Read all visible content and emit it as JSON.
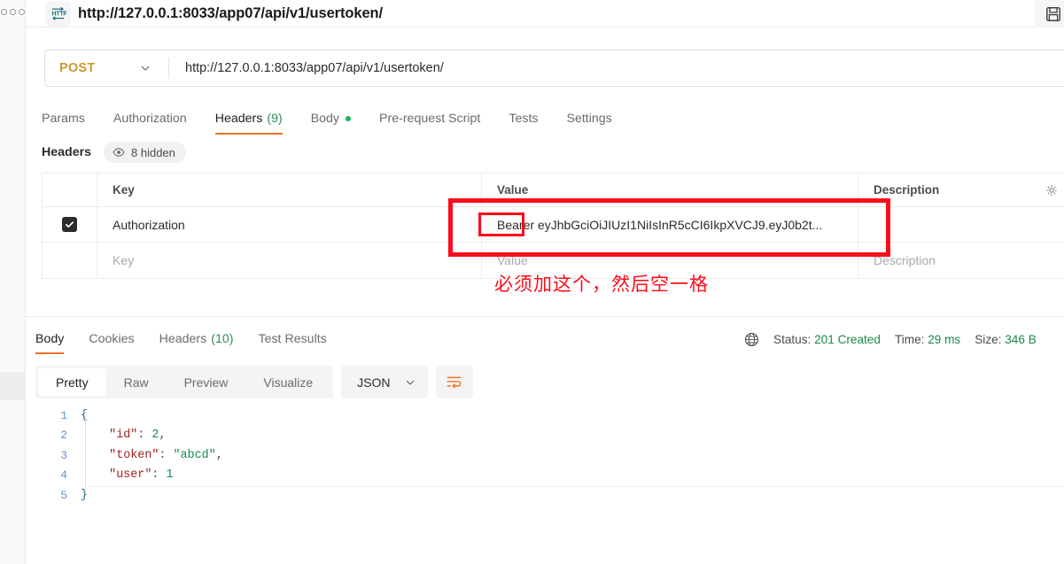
{
  "titlebar": {
    "protocol_icon": "http-icon",
    "tab_title": "http://127.0.0.1:8033/app07/api/v1/usertoken/",
    "save_icon": "save-disk-icon"
  },
  "request": {
    "method": "POST",
    "method_caret_icon": "chevron-down-icon",
    "url": "http://127.0.0.1:8033/app07/api/v1/usertoken/",
    "tabs": [
      {
        "label": "Params",
        "count": "",
        "active": false,
        "dot": false
      },
      {
        "label": "Authorization",
        "count": "",
        "active": false,
        "dot": false
      },
      {
        "label": "Headers",
        "count": "(9)",
        "active": true,
        "dot": false
      },
      {
        "label": "Body",
        "count": "",
        "active": false,
        "dot": true
      },
      {
        "label": "Pre-request Script",
        "count": "",
        "active": false,
        "dot": false
      },
      {
        "label": "Tests",
        "count": "",
        "active": false,
        "dot": false
      },
      {
        "label": "Settings",
        "count": "",
        "active": false,
        "dot": false
      }
    ]
  },
  "headers_panel": {
    "title": "Headers",
    "hidden_chip_label": "8 hidden",
    "eye_icon": "eye-icon",
    "gear_icon": "gear-icon",
    "columns": {
      "key": "Key",
      "value": "Value",
      "description": "Description"
    },
    "rows": [
      {
        "checked": true,
        "key": "Authorization",
        "value_prefix": "Bearer",
        "value_token": "eyJhbGciOiJIUzI1NiIsInR5cCI6IkpXVCJ9.eyJ0b2t...",
        "description": ""
      }
    ],
    "placeholder_row": {
      "key": "Key",
      "value": "Value",
      "description": "Description"
    }
  },
  "annotation": {
    "text": "必须加这个，然后空一格",
    "color": "#fc0d1b"
  },
  "response": {
    "tabs": [
      {
        "label": "Body",
        "count": "",
        "active": true
      },
      {
        "label": "Cookies",
        "count": "",
        "active": false
      },
      {
        "label": "Headers",
        "count": "(10)",
        "active": false
      },
      {
        "label": "Test Results",
        "count": "",
        "active": false
      }
    ],
    "globe_icon": "globe-icon",
    "status_label": "Status:",
    "status_value": "201 Created",
    "time_label": "Time:",
    "time_value": "29 ms",
    "size_label": "Size:",
    "size_value": "346 B",
    "view_modes": [
      {
        "label": "Pretty",
        "active": true
      },
      {
        "label": "Raw",
        "active": false
      },
      {
        "label": "Preview",
        "active": false
      },
      {
        "label": "Visualize",
        "active": false
      }
    ],
    "format": "JSON",
    "format_caret_icon": "chevron-down-icon",
    "wrap_icon": "wrap-lines-icon",
    "body_lines": [
      {
        "num": "1",
        "indent": 0,
        "parts": [
          {
            "t": "{",
            "c": "tok-brace"
          }
        ]
      },
      {
        "num": "2",
        "indent": 1,
        "parts": [
          {
            "t": "\"id\"",
            "c": "tok-key"
          },
          {
            "t": ": ",
            "c": "tok-pun"
          },
          {
            "t": "2",
            "c": "tok-num"
          },
          {
            "t": ",",
            "c": "tok-pun"
          }
        ]
      },
      {
        "num": "3",
        "indent": 1,
        "parts": [
          {
            "t": "\"token\"",
            "c": "tok-key"
          },
          {
            "t": ": ",
            "c": "tok-pun"
          },
          {
            "t": "\"abcd\"",
            "c": "tok-str"
          },
          {
            "t": ",",
            "c": "tok-pun"
          }
        ]
      },
      {
        "num": "4",
        "indent": 1,
        "parts": [
          {
            "t": "\"user\"",
            "c": "tok-key"
          },
          {
            "t": ": ",
            "c": "tok-pun"
          },
          {
            "t": "1",
            "c": "tok-num"
          }
        ]
      },
      {
        "num": "5",
        "indent": 0,
        "parts": [
          {
            "t": "}",
            "c": "tok-brace"
          }
        ]
      }
    ]
  },
  "colors": {
    "accent_orange": "#ef7028",
    "method_post": "#c99a2e",
    "success_green": "#1a8a4c",
    "annotation_red": "#fc0d1b"
  }
}
